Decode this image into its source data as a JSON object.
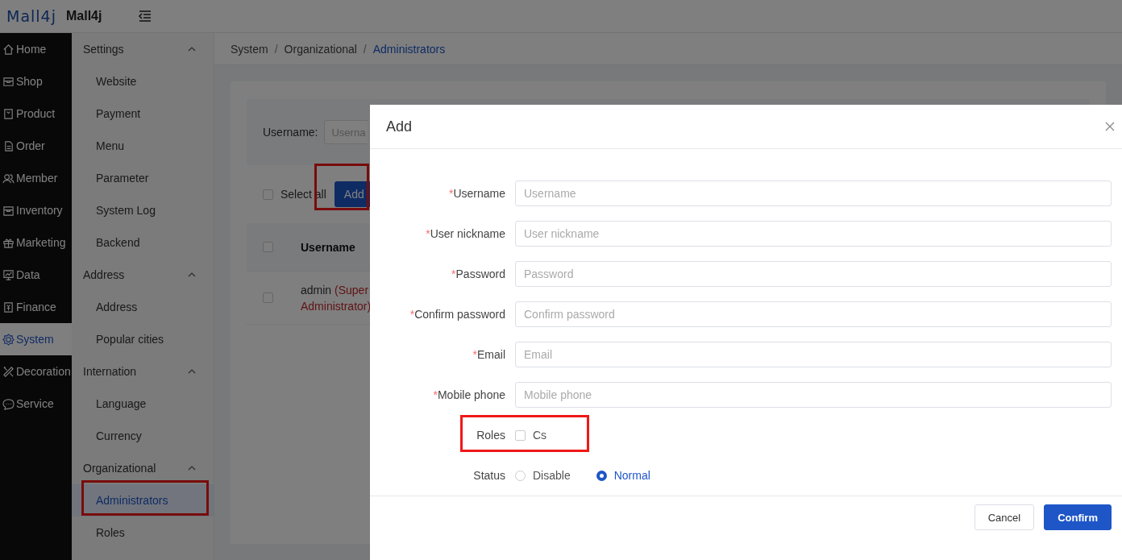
{
  "header": {
    "logo": "Mall4j",
    "title": "Mall4j"
  },
  "nav": [
    {
      "label": "Home",
      "selected": false
    },
    {
      "label": "Shop",
      "selected": false
    },
    {
      "label": "Product",
      "selected": false
    },
    {
      "label": "Order",
      "selected": false
    },
    {
      "label": "Member",
      "selected": false
    },
    {
      "label": "Inventory",
      "selected": false
    },
    {
      "label": "Marketing",
      "selected": false
    },
    {
      "label": "Data",
      "selected": false
    },
    {
      "label": "Finance",
      "selected": false
    },
    {
      "label": "System",
      "selected": true
    },
    {
      "label": "Decoration",
      "selected": false
    },
    {
      "label": "Service",
      "selected": false
    }
  ],
  "submenu": [
    {
      "title": "Settings",
      "expanded": true,
      "children": [
        {
          "label": "Website",
          "selected": false,
          "highlighted": false
        },
        {
          "label": "Payment",
          "selected": false,
          "highlighted": false
        },
        {
          "label": "Menu",
          "selected": false,
          "highlighted": false
        },
        {
          "label": "Parameter",
          "selected": false,
          "highlighted": false
        },
        {
          "label": "System Log",
          "selected": false,
          "highlighted": false
        },
        {
          "label": "Backend",
          "selected": false,
          "highlighted": false
        }
      ]
    },
    {
      "title": "Address",
      "expanded": true,
      "children": [
        {
          "label": "Address",
          "selected": false,
          "highlighted": false
        },
        {
          "label": "Popular cities",
          "selected": false,
          "highlighted": false
        }
      ]
    },
    {
      "title": "Internation",
      "expanded": true,
      "children": [
        {
          "label": "Language",
          "selected": false,
          "highlighted": false
        },
        {
          "label": "Currency",
          "selected": false,
          "highlighted": false
        }
      ]
    },
    {
      "title": "Organizational",
      "expanded": true,
      "children": [
        {
          "label": "Administrators",
          "selected": true,
          "highlighted": true
        },
        {
          "label": "Roles",
          "selected": false,
          "highlighted": false
        }
      ]
    }
  ],
  "breadcrumb": [
    {
      "label": "System",
      "current": false
    },
    {
      "separator": "/",
      "label": "Organizational",
      "current": false
    },
    {
      "separator": "/",
      "label": "Administrators",
      "current": true
    }
  ],
  "search": {
    "label": "Username:",
    "placeholder": "Userna"
  },
  "toolbar": {
    "select_all": {
      "label": "Select all",
      "checked": false
    },
    "add_button": {
      "label": "Add",
      "highlighted": true
    }
  },
  "table": {
    "header_checked": false,
    "columns": [
      {
        "label": "Username"
      }
    ],
    "rows": [
      {
        "name": "admin",
        "role": "(Super Administrator)",
        "checked": false
      }
    ]
  },
  "dialog": {
    "title": "Add",
    "fields": [
      {
        "kind": "text",
        "required_mark": "*",
        "label": "Username",
        "placeholder": "Username"
      },
      {
        "kind": "text",
        "required_mark": "*",
        "label": "User nickname",
        "placeholder": "User nickname"
      },
      {
        "kind": "text",
        "required_mark": "*",
        "label": "Password",
        "placeholder": "Password"
      },
      {
        "kind": "text",
        "required_mark": "*",
        "label": "Confirm password",
        "placeholder": "Confirm password"
      },
      {
        "kind": "text",
        "required_mark": "*",
        "label": "Email",
        "placeholder": "Email"
      },
      {
        "kind": "text",
        "required_mark": "*",
        "label": "Mobile phone",
        "placeholder": "Mobile phone"
      },
      {
        "kind": "checkbox",
        "label": "Roles",
        "highlighted": true,
        "options": [
          {
            "label": "Cs",
            "checked": false
          }
        ]
      },
      {
        "kind": "radio",
        "label": "Status",
        "options": [
          {
            "label": "Disable",
            "selected": false
          },
          {
            "label": "Normal",
            "selected": true
          }
        ]
      }
    ],
    "buttons": [
      {
        "kind": "default",
        "label": "Cancel"
      },
      {
        "kind": "primary",
        "label": "Confirm"
      }
    ]
  }
}
